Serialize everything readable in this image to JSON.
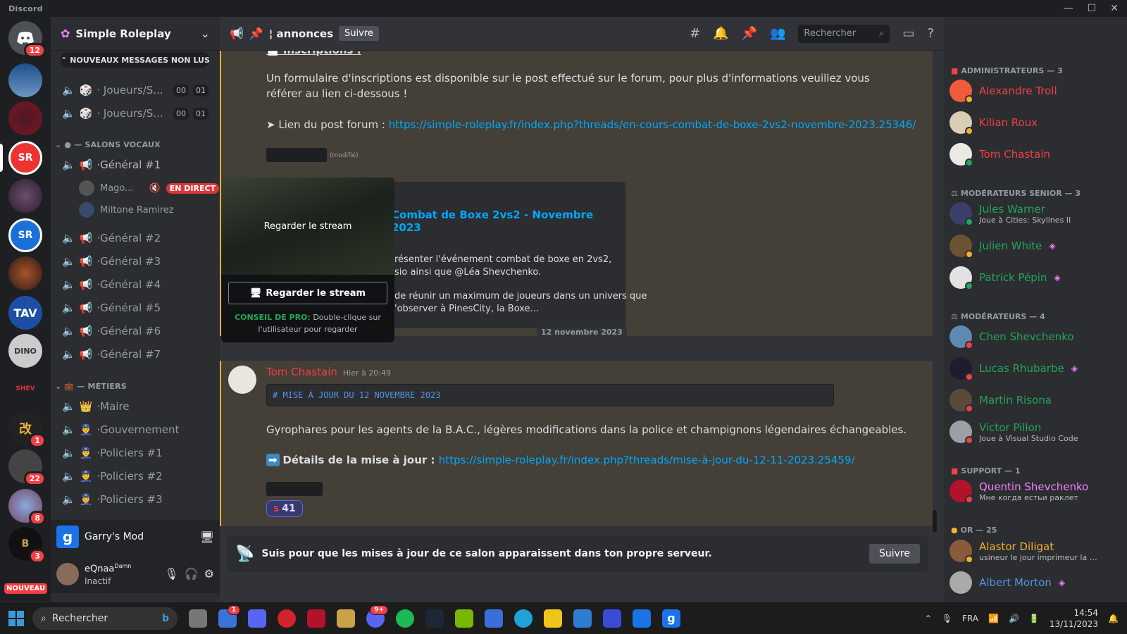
{
  "window": {
    "title": "Discord"
  },
  "colors": {
    "accent": "#5865f2",
    "admin": "#f23f43",
    "mod": "#23a55a",
    "support": "#f47fff",
    "or": "#f0b132",
    "link": "#00a8fc"
  },
  "guilds": {
    "home_badge": "12",
    "badges": [
      "1",
      "22",
      "8",
      "3"
    ],
    "new_label": "NOUVEAU"
  },
  "server": {
    "name": "Simple Roleplay",
    "new_messages": "NOUVEAUX MESSAGES NON LUS",
    "channels_top": [
      {
        "label": "· Joueurs/S...",
        "c1": "00",
        "c2": "01"
      },
      {
        "label": "· Joueurs/S...",
        "c1": "00",
        "c2": "01"
      }
    ],
    "cat_voice": "— SALONS VOCAUX",
    "cat_metiers": "— MÉTIERS",
    "voice_channels": [
      "·Général #1",
      "·Général #2",
      "·Général #3",
      "·Général #4",
      "·Général #5",
      "·Général #6",
      "·Général #7"
    ],
    "voice_users": [
      {
        "name": "Mago...",
        "live": "EN DIRECT"
      },
      {
        "name": "Miltone Ramirez"
      }
    ],
    "metiers": [
      "·Maire",
      "·Gouvernement",
      "·Policiers #1",
      "·Policiers #2",
      "·Policiers #3"
    ]
  },
  "activity": {
    "game": "Garry's Mod"
  },
  "user": {
    "name": "eQnaa",
    "tag": "Damn",
    "status": "Inactif"
  },
  "channel": {
    "name": "annonces",
    "follow": "Suivre",
    "search_placeholder": "Rechercher"
  },
  "messages": {
    "heading": "Inscriptions :",
    "p1": "Un formulaire d'inscriptions est disponible sur le post effectué sur le forum, pour plus d'informations veuillez vous référer au lien ci-dessous !",
    "p2_prefix": "➤ Lien du post forum : ",
    "p2_link": "https://simple-roleplay.fr/index.php?threads/en-cours-combat-de-boxe-2vs2-novembre-2023.25346/",
    "edited": "(modifié)",
    "embed_title": "Combat de Boxe 2vs2 - Novembre 2023",
    "embed_l1": "résenter l'événement combat de boxe en 2vs2,",
    "embed_l2": "sio ainsi que @Léa Shevchenko.",
    "embed_l3": "de réunir un maximum de joueurs dans un univers que",
    "embed_l4": "'observer à PinesCity, la Boxe...",
    "date_divider": "12 novembre 2023",
    "author": "Tom Chastain",
    "time": "Hier à 20:49",
    "code": "# MISE À JOUR DU 12 NOVEMBRE 2023",
    "p3": "Gyrophares pour les agents de la B.A.C., légères modifications dans la police et champignons légendaires échangeables.",
    "p4_bold": "Détails de la mise à jour : ",
    "p4_link": "https://simple-roleplay.fr/index.php?threads/mise-à-jour-du-12-11-2023.25459/",
    "reaction_count": "41"
  },
  "popup": {
    "preview_label": "Regarder le stream",
    "button": "Regarder le stream",
    "tip_bold": "CONSEIL DE PRO:",
    "tip": " Double-clique sur l'utilisateur pour regarder"
  },
  "follow_bar": {
    "text": "Suis pour que les mises à jour de ce salon apparaissent dans ton propre serveur.",
    "button": "Suivre"
  },
  "members": {
    "cat_admin": "ADMINISTRATEURS — 3",
    "admins": [
      "Alexandre Troll",
      "Kilian Roux",
      "Tom Chastain"
    ],
    "cat_modsr": "MODÉRATEURS SENIOR — 3",
    "modsr": [
      {
        "name": "Jules Warner",
        "sub": "Joue à Cities: Skylines II"
      },
      {
        "name": "Julien White"
      },
      {
        "name": "Patrick Pépin"
      }
    ],
    "cat_mod": "MODÉRATEURS — 4",
    "mods": [
      {
        "name": "Chen Shevchenko"
      },
      {
        "name": "Lucas Rhubarbe"
      },
      {
        "name": "Martin Risona"
      },
      {
        "name": "Victor Pillon",
        "sub": "Joue à Visual Studio Code"
      }
    ],
    "cat_support": "SUPPORT — 1",
    "support": [
      {
        "name": "Quentin Shevchenko",
        "sub": "Мне когда естьи раклет"
      }
    ],
    "cat_or": "OR — 25",
    "or": [
      {
        "name": "Alastor Diligat",
        "sub": "usineur le jour imprimeur la n..."
      },
      {
        "name": "Albert Morton"
      }
    ]
  },
  "taskbar": {
    "search": "Rechercher",
    "lang": "FRA",
    "time": "14:54",
    "date": "13/11/2023",
    "discord_badge": "9+",
    "notif_badge": "1"
  }
}
